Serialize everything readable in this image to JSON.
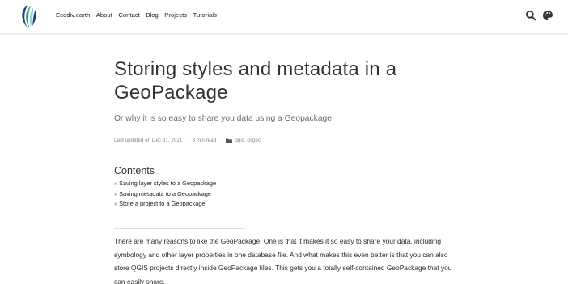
{
  "navbar": {
    "brand": "Ecodiv.earth",
    "links": [
      "About",
      "Contact",
      "Blog",
      "Projects",
      "Tutorials"
    ]
  },
  "article": {
    "title": "Storing styles and metadata in a GeoPackage",
    "subtitle": "Or why it is so easy to share you data using a Geopackage.",
    "meta": {
      "updated": "Last updated on Dec 31, 2021",
      "read_time": "3 min read",
      "tags": "qgis, osgeo"
    },
    "toc": {
      "title": "Contents",
      "items": [
        "Saving layer styles to a Geopackage",
        "Saving metadata to a Geopackage",
        "Store a project to a Geopackage"
      ]
    },
    "paragraph": "There are many reasons to like the GeoPackage. One is that it makes it so easy to share your data, including symbology and other layer properties in one database file. And what makes this even better is that you can also store QGIS projects directly inside GeoPackage files. This gets you a totally self-contained GeoPackage that you can easily share."
  },
  "icons": {
    "logo": "ecodiv-logo",
    "search": "search-icon",
    "theme": "palette-icon",
    "tag": "folder-icon"
  },
  "colors": {
    "logo_dark": "#1b3f8f",
    "logo_green": "#3aa84a",
    "logo_light": "#9ad0e8"
  }
}
